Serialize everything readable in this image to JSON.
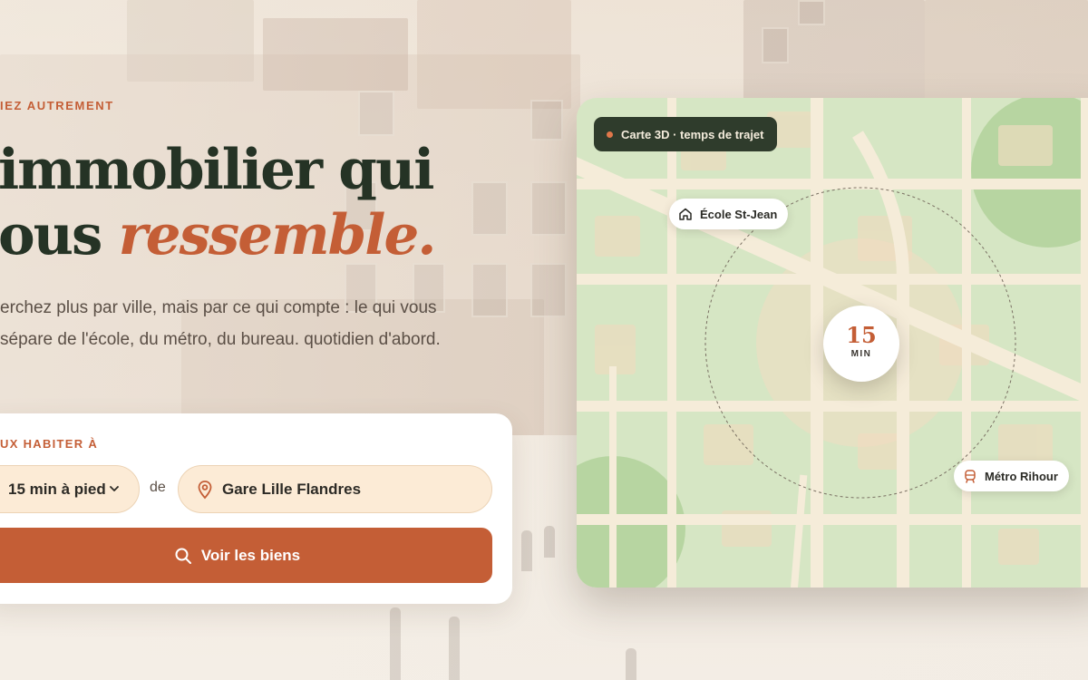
{
  "hero": {
    "eyebrow": "IEZ AUTREMENT",
    "headline_line1": "immobilier qui",
    "headline_line2_prefix": "ous ",
    "headline_line2_accent": "ressemble.",
    "lead": "erchez plus par ville, mais par ce qui compte : le qui vous sépare de l'école, du métro, du bureau. quotidien d'abord."
  },
  "search": {
    "label": "UX HABITER À",
    "duration_value": "15 min à pied",
    "connector": "de",
    "location_value": "Gare Lille Flandres",
    "cta_label": "Voir les biens"
  },
  "map": {
    "badge": "Carte 3D · temps de trajet",
    "poi_school": "École St-Jean",
    "poi_metro": "Métro Rihour",
    "time_value": "15",
    "time_unit": "MIN",
    "colors": {
      "accent": "#c45e36",
      "dark_green": "#2f3c2c",
      "map_land": "#d6e6c4",
      "map_road": "#f5ecd9"
    }
  },
  "icons": [
    "chevron-down-icon",
    "location-pin-icon",
    "search-icon",
    "home-icon",
    "metro-icon"
  ]
}
